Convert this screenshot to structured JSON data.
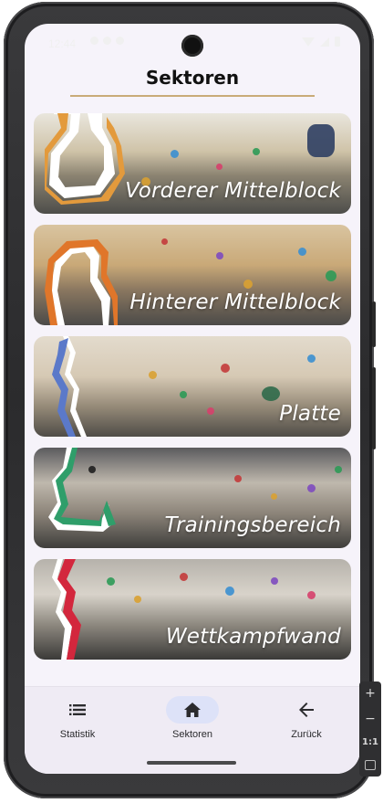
{
  "status_bar": {
    "time": "12:44"
  },
  "header": {
    "title": "Sektoren"
  },
  "sectors": [
    {
      "name": "Vorderer Mittelblock",
      "accent": "#e39a3c"
    },
    {
      "name": "Hinterer Mittelblock",
      "accent": "#e0762a"
    },
    {
      "name": "Platte",
      "accent": "#5b79c9"
    },
    {
      "name": "Trainingsbereich",
      "accent": "#2f9e6a"
    },
    {
      "name": "Wettkampfwand",
      "accent": "#d3273d"
    }
  ],
  "bottom_nav": {
    "items": [
      {
        "label": "Statistik",
        "icon": "list-icon"
      },
      {
        "label": "Sektoren",
        "icon": "home-icon",
        "active": true
      },
      {
        "label": "Zurück",
        "icon": "arrow-back-icon"
      }
    ]
  },
  "emulator_controls": {
    "zoom_in": "+",
    "zoom_out": "−",
    "ratio": "1:1"
  },
  "colors": {
    "active_pill": "#dde2f8",
    "title_rule": "#c9ab78"
  }
}
